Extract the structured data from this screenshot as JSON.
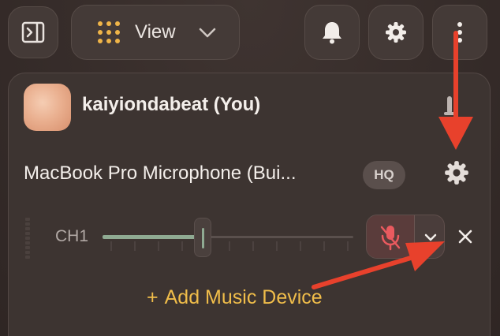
{
  "toolbar": {
    "sidebar_icon": "sidebar-toggle-icon",
    "view_label": "View",
    "view_icon": "grid-icon",
    "bell_icon": "bell-icon",
    "settings_icon": "gear-icon",
    "more_icon": "more-vertical-icon"
  },
  "user": {
    "name": "kaiyiondabeat (You)",
    "pin_icon": "pin-icon"
  },
  "device": {
    "name": "MacBook Pro Microphone (Bui...",
    "quality_badge": "HQ",
    "settings_icon": "gear-icon"
  },
  "channel": {
    "label": "CH1",
    "volume_level": 0.4,
    "mute_icon": "microphone-muted-icon",
    "dropdown_icon": "chevron-down-icon",
    "remove_icon": "close-icon"
  },
  "add_device_label": "Add Music Device",
  "colors": {
    "accent": "#f0bd4a",
    "annotation_arrow": "#e8412c",
    "muted_mic": "#ea5a5f",
    "slider_fill": "#8faa92"
  }
}
